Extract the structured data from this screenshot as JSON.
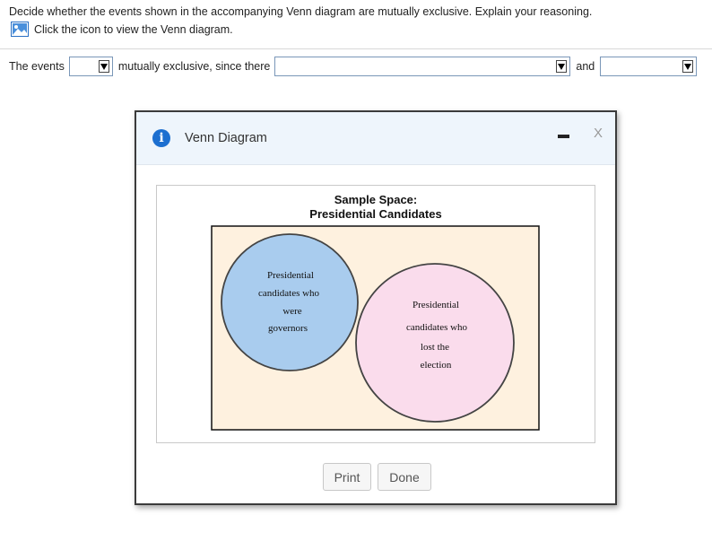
{
  "question": {
    "text": "Decide whether the events shown in the accompanying Venn diagram are mutually exclusive. Explain your reasoning.",
    "view_link_label": "Click the icon to view the Venn diagram."
  },
  "answer": {
    "prefix": "The events",
    "middle": "mutually exclusive, since there",
    "conjunction": "and",
    "dropdown1_value": "",
    "dropdown2_value": "",
    "dropdown3_value": ""
  },
  "dialog": {
    "title": "Venn Diagram",
    "close_label": "X",
    "print_label": "Print",
    "done_label": "Done"
  },
  "venn": {
    "title_line1": "Sample Space:",
    "title_line2": "Presidential Candidates",
    "set_a": {
      "lines": [
        "Presidential",
        "candidates who",
        "were",
        "governors"
      ],
      "color": "#a9ccee"
    },
    "set_b": {
      "lines": [
        "Presidential",
        "candidates who",
        "lost the",
        "election"
      ],
      "color": "#fadcec"
    },
    "overlap_color": "#8f87bd",
    "background_color": "#fef1df"
  },
  "colors": {
    "info_icon": "#1c6fd0",
    "dialog_header": "#eef5fc"
  }
}
